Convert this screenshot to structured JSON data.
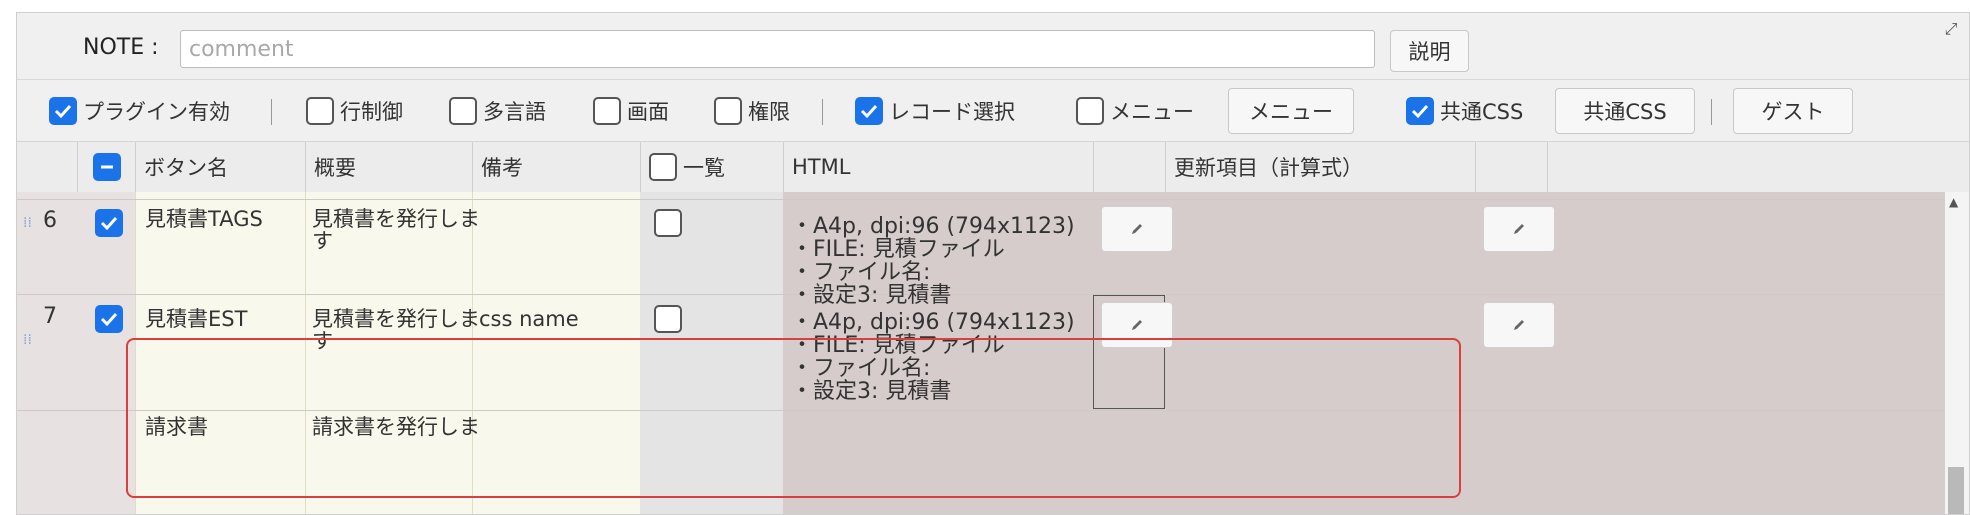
{
  "note": {
    "label": "NOTE :",
    "placeholder": "comment",
    "help_button": "説明"
  },
  "options": [
    {
      "label": "プラグイン有効",
      "checked": true
    },
    {
      "label": "行制御",
      "checked": false
    },
    {
      "label": "多言語",
      "checked": false
    },
    {
      "label": "画面",
      "checked": false
    },
    {
      "label": "権限",
      "checked": false
    },
    {
      "label": "レコード選択",
      "checked": true
    },
    {
      "label": "メニュー",
      "checked": false
    }
  ],
  "menu_button": "メニュー",
  "css_option": {
    "label": "共通CSS",
    "checked": true
  },
  "css_button": "共通CSS",
  "guest_button": "ゲスト",
  "columns": {
    "button_name": "ボタン名",
    "summary": "概要",
    "remarks": "備考",
    "list": "一覧",
    "html": "HTML",
    "update": "更新項目（計算式）"
  },
  "rows": [
    {
      "index": "6",
      "checked": true,
      "button_name": "見積書TAGS",
      "summary_line1": "見積書を発行しま",
      "summary_line2": "す",
      "remarks": "",
      "list_checked": false,
      "html_lines": [
        "・A4p, dpi:96 (794x1123)",
        "・FILE: 見積ファイル",
        "・ファイル名:",
        "・設定3: 見積書"
      ]
    },
    {
      "index": "7",
      "checked": true,
      "button_name": "見積書EST",
      "summary_line1": "見積書を発行しま",
      "summary_line2": "す",
      "remarks": "css name",
      "list_checked": false,
      "html_lines": [
        "・A4p, dpi:96 (794x1123)",
        "・FILE: 見積ファイル",
        "・ファイル名:",
        "・設定3: 見積書"
      ]
    },
    {
      "index": "",
      "button_name": "請求書",
      "summary_line1": "請求書を発行しま"
    }
  ],
  "colors": {
    "accent": "#1a73e8",
    "highlight": "#d93f3f",
    "name_cells": "#f9f8ec",
    "html_cells": "#d6cccc",
    "list_cells": "#e4e4e4"
  }
}
